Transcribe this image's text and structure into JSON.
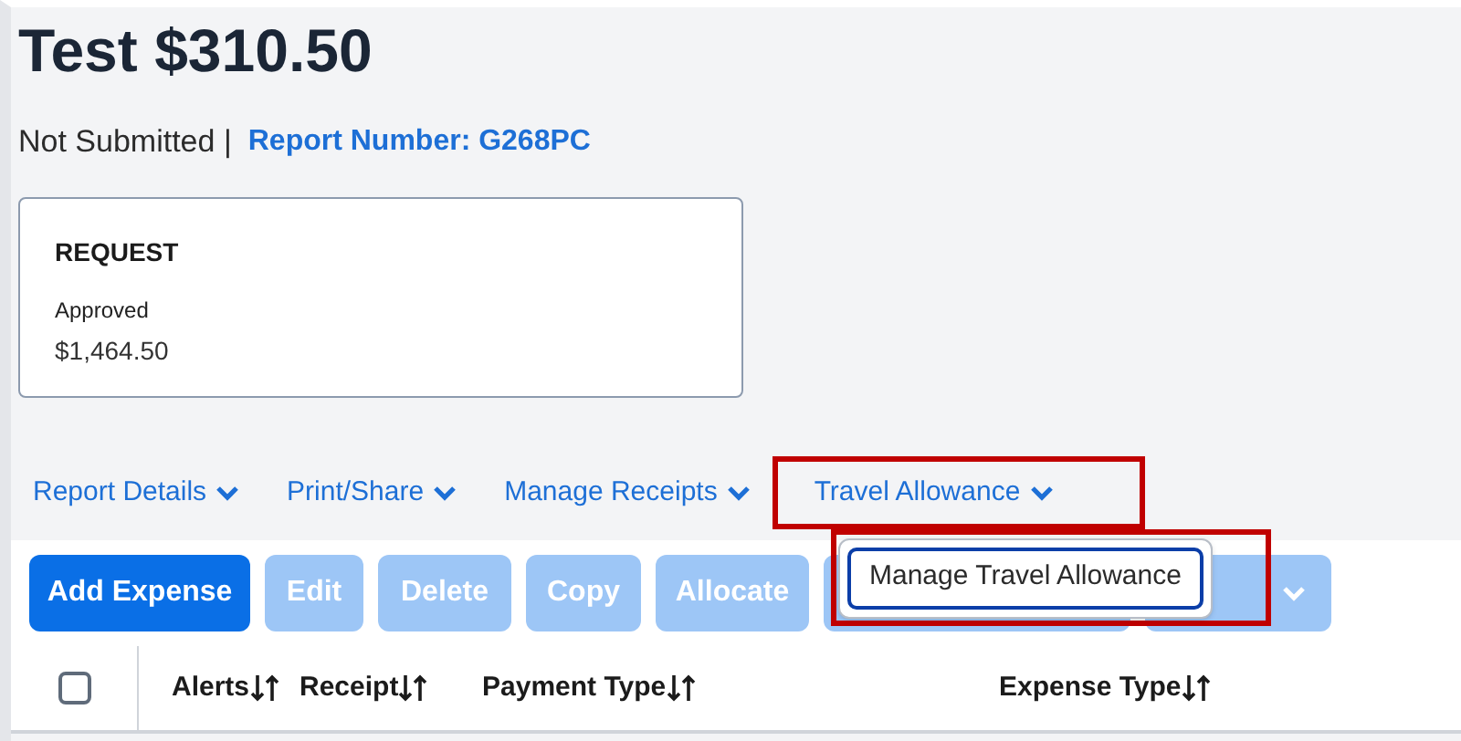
{
  "header": {
    "title": "Test $310.50",
    "status": "Not Submitted |",
    "report_number": "Report Number: G268PC"
  },
  "request_card": {
    "heading": "REQUEST",
    "status": "Approved",
    "amount": "$1,464.50"
  },
  "nav_menus": [
    {
      "label": "Report Details",
      "highlighted": false
    },
    {
      "label": "Print/Share",
      "highlighted": false
    },
    {
      "label": "Manage Receipts",
      "highlighted": false
    },
    {
      "label": "Travel Allowance",
      "highlighted": true
    }
  ],
  "dropdown": {
    "items": [
      {
        "label": "Manage Travel Allowance",
        "highlighted": true
      }
    ]
  },
  "toolbar": [
    {
      "label": "Add Expense",
      "disabled": false
    },
    {
      "label": "Edit",
      "disabled": true
    },
    {
      "label": "Delete",
      "disabled": true
    },
    {
      "label": "Copy",
      "disabled": true
    },
    {
      "label": "Allocate",
      "disabled": true
    },
    {
      "disabled": true,
      "kind": "hidden"
    },
    {
      "disabled": true,
      "kind": "menu"
    }
  ],
  "table": {
    "select_all": {
      "checked": false
    },
    "columns": [
      "Alerts",
      "Receipt",
      "Payment Type",
      "Expense Type"
    ]
  }
}
